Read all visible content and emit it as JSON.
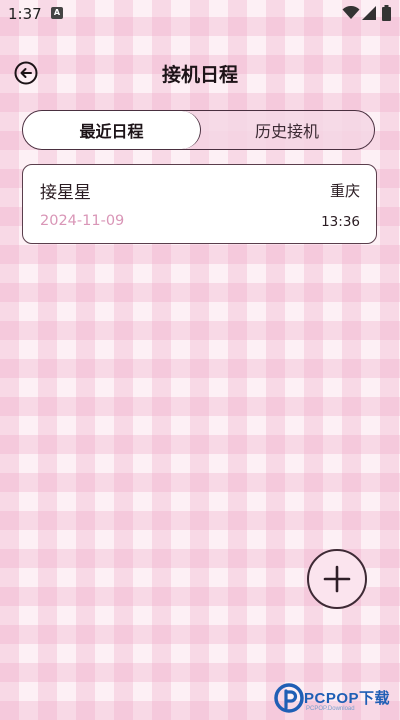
{
  "status_bar": {
    "time": "1:37",
    "notification_icon": "A",
    "icons": [
      "notification-icon",
      "wifi-icon",
      "signal-icon",
      "battery-icon"
    ]
  },
  "header": {
    "title": "接机日程",
    "back_icon": "back-arrow-icon"
  },
  "tabs": [
    {
      "label": "最近日程",
      "active": true
    },
    {
      "label": "历史接机",
      "active": false
    }
  ],
  "schedules": [
    {
      "name": "接星星",
      "city": "重庆",
      "date": "2024-11-09",
      "time": "13:36"
    }
  ],
  "add_button": {
    "icon": "plus-icon"
  },
  "watermark": {
    "brand": "PCPOP下载",
    "sub": "PCPOP.Download"
  },
  "colors": {
    "accent_date": "#d996b7",
    "border": "#4a3040",
    "plaid_pink": "#eea8c6",
    "watermark_blue": "#1f5fb5"
  }
}
